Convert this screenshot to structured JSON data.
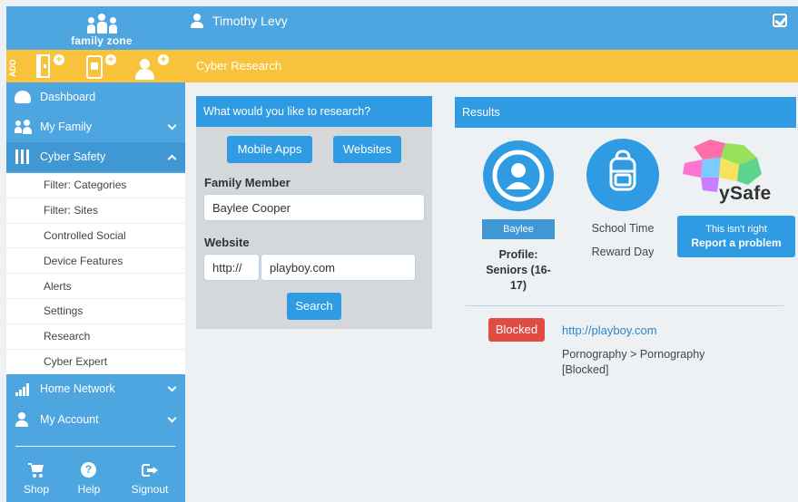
{
  "brand": {
    "logo_text": "family zone"
  },
  "topbar": {
    "user_name": "Timothy Levy",
    "check_icon": "check-square-icon"
  },
  "addbar": {
    "add_label": "ADD",
    "devices": [
      "door-device-icon",
      "tablet-device-icon",
      "person-add-icon"
    ]
  },
  "breadcrumb": {
    "current": "Cyber Research"
  },
  "sidebar": {
    "items": [
      {
        "label": "Dashboard",
        "icon": "dashboard-icon"
      },
      {
        "label": "My Family",
        "icon": "family-icon"
      },
      {
        "label": "Cyber Safety",
        "icon": "sliders-icon"
      },
      {
        "label": "Home Network",
        "icon": "signal-icon"
      },
      {
        "label": "My Account",
        "icon": "user-icon"
      }
    ],
    "subitems": [
      "Filter: Categories",
      "Filter: Sites",
      "Controlled Social",
      "Device Features",
      "Alerts",
      "Settings",
      "Research",
      "Cyber Expert"
    ],
    "footer": [
      {
        "label": "Shop",
        "icon": "cart-icon"
      },
      {
        "label": "Help",
        "icon": "help-icon"
      },
      {
        "label": "Signout",
        "icon": "signout-icon"
      }
    ]
  },
  "research": {
    "heading": "What would you like to research?",
    "mobile_apps_label": "Mobile Apps",
    "websites_label": "Websites",
    "family_member_label": "Family Member",
    "family_member_value": "Baylee Cooper",
    "website_label": "Website",
    "protocol_value": "http://",
    "website_value": "playboy.com",
    "search_label": "Search"
  },
  "results": {
    "heading": "Results",
    "member_name": "Baylee",
    "profile_text": "Profile: Seniors (16-17)",
    "schedule_1": "School Time",
    "schedule_2": "Reward Day",
    "ysafe_text": "ySafe",
    "report_line1": "This isn't right",
    "report_line2": "Report a problem",
    "status_badge": "Blocked",
    "url": "http://playboy.com",
    "category": "Pornography > Pornography [Blocked]"
  },
  "colors": {
    "primary": "#4da6e0",
    "header_blue": "#2f9be3",
    "yellow": "#f8c33a",
    "blocked_red": "#df4c42",
    "panel_grey": "#d5d8db"
  }
}
